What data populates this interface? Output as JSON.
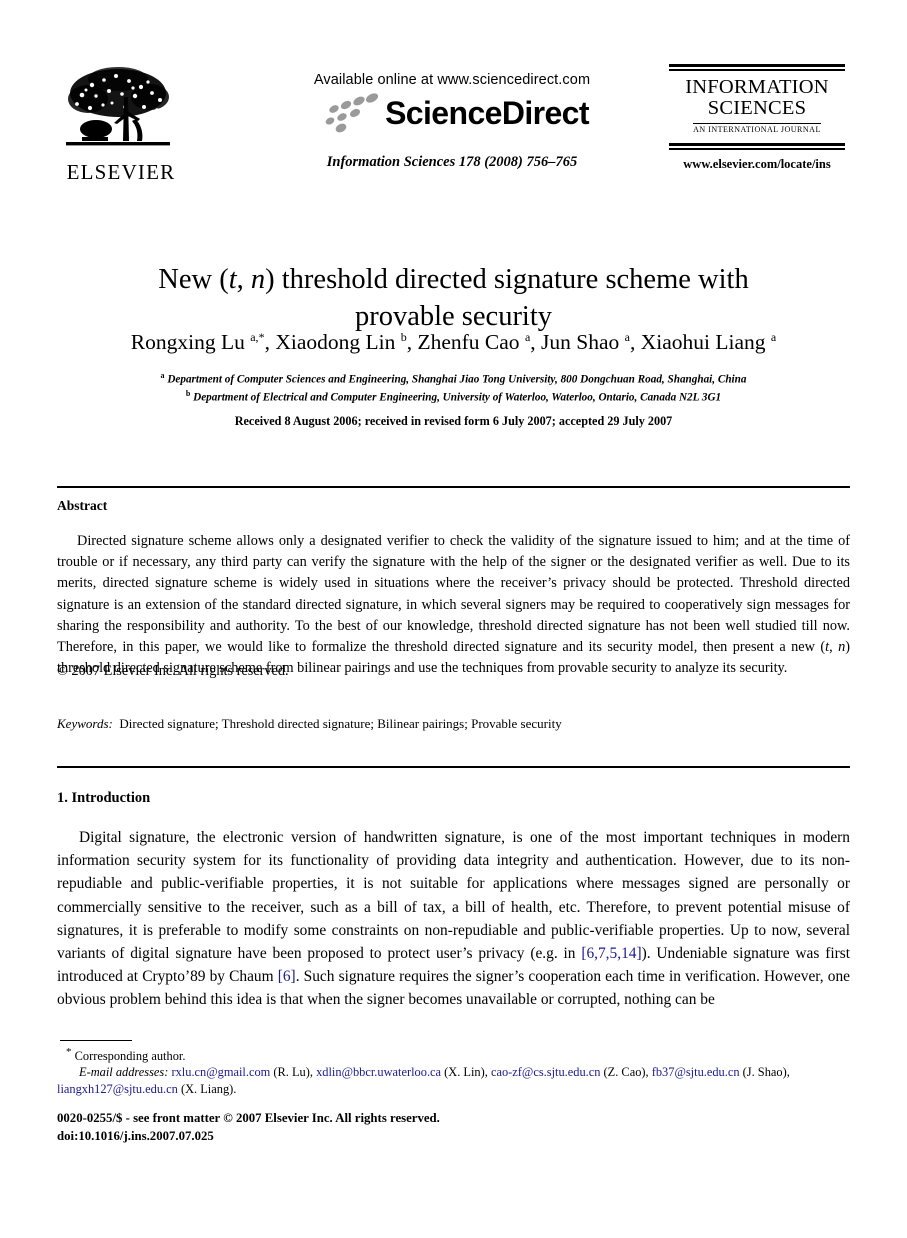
{
  "header": {
    "publisher_logo_name": "ELSEVIER",
    "available_online": "Available online at www.sciencedirect.com",
    "sciencedirect_wordmark": "ScienceDirect",
    "journal_reference": "Information Sciences 178 (2008) 756–765",
    "journal_logo_line1": "INFORMATION",
    "journal_logo_line2": "SCIENCES",
    "journal_logo_subtitle": "AN INTERNATIONAL JOURNAL",
    "journal_url": "www.elsevier.com/locate/ins"
  },
  "article": {
    "title_line1_pre": "New (",
    "title_t": "t",
    "title_comma": ", ",
    "title_n": "n",
    "title_line1_post": ") threshold directed signature scheme with",
    "title_line2": "provable security",
    "authors": "Rongxing Lu a,*, Xiaodong Lin b, Zhenfu Cao a, Jun Shao a, Xiaohui Liang a",
    "affiliation_a": "Department of Computer Sciences and Engineering, Shanghai Jiao Tong University, 800 Dongchuan Road, Shanghai, China",
    "affiliation_b": "Department of Electrical and Computer Engineering, University of Waterloo, Waterloo, Ontario, Canada N2L 3G1",
    "received_line": "Received 8 August 2006; received in revised form 6 July 2007; accepted 29 July 2007"
  },
  "abstract": {
    "heading": "Abstract",
    "paragraph_part1": "Directed signature scheme allows only a designated verifier to check the validity of the signature issued to him; and at the time of trouble or if necessary, any third party can verify the signature with the help of the signer or the designated verifier as well. Due to its merits, directed signature scheme is widely used in situations where the receiver’s privacy should be protected. Threshold directed signature is an extension of the standard directed signature, in which several signers may be required to cooperatively sign messages for sharing the responsibility and authority. To the best of our knowledge, threshold directed signature has not been well studied till now. Therefore, in this paper, we would like to formalize the threshold directed signature and its security model, then present a new (",
    "paragraph_t": "t",
    "paragraph_comma": ", ",
    "paragraph_n": "n",
    "paragraph_part2": ") threshold directed signature scheme from bilinear pairings and use the techniques from provable security to analyze its security.",
    "copyright": "© 2007 Elsevier Inc. All rights reserved.",
    "keywords_label": "Keywords:",
    "keywords_value": "Directed signature; Threshold directed signature; Bilinear pairings; Provable security"
  },
  "introduction": {
    "heading": "1. Introduction",
    "text_part1": "Digital signature, the electronic version of handwritten signature, is one of the most important techniques in modern information security system for its functionality of providing data integrity and authentication. However, due to its non-repudiable and public-verifiable properties, it is not suitable for applications where messages signed are personally or commercially sensitive to the receiver, such as a bill of tax, a bill of health, etc. Therefore, to prevent potential misuse of signatures, it is preferable to modify some constraints on non-repudiable and public-verifiable properties. Up to now, several variants of digital signature have been proposed to protect user’s privacy (e.g. in ",
    "citation_1": "[6,7,5,14]",
    "text_part2": "). Undeniable signature was first introduced at Crypto’89 by Chaum ",
    "citation_2": "[6]",
    "text_part3": ". Such signature requires the signer’s cooperation each time in verification. However, one obvious problem behind this idea is that when the signer becomes unavailable or corrupted, nothing can be"
  },
  "footnotes": {
    "corresponding_marker": "*",
    "corresponding_text": "Corresponding author.",
    "email_label": "E-mail addresses:",
    "emails": [
      {
        "address": "rxlu.cn@gmail.com",
        "person": "(R. Lu)"
      },
      {
        "address": "xdlin@bbcr.uwaterloo.ca",
        "person": "(X. Lin)"
      },
      {
        "address": "cao-zf@cs.sjtu.edu.cn",
        "person": "(Z. Cao)"
      },
      {
        "address": "fb37@sjtu.edu.cn",
        "person": "(J. Shao)"
      },
      {
        "address": "liangxh127@sjtu.edu.cn",
        "person": "(X. Liang)"
      }
    ],
    "issn_line": "0020-0255/$ - see front matter © 2007 Elsevier Inc. All rights reserved.",
    "doi_line": "doi:10.1016/j.ins.2007.07.025"
  },
  "colors": {
    "link": "#1a1a8c",
    "text": "#000000",
    "background": "#ffffff",
    "logo_gray": "#9a9a9a"
  }
}
